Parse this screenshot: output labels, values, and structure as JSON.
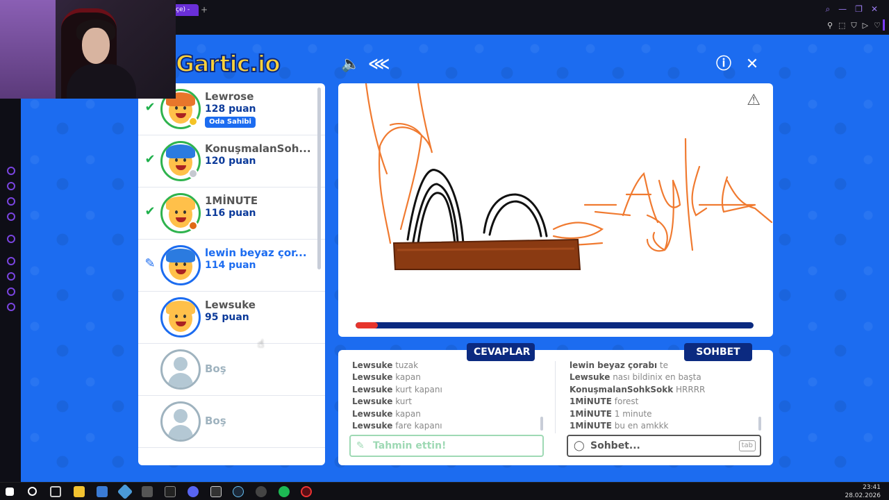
{
  "browser": {
    "tab_title": "çe) - ",
    "tab_add": "+"
  },
  "game": {
    "logo": "Gartic.io",
    "icons": [
      "sound-icon",
      "share-icon",
      "info-icon",
      "close-icon"
    ]
  },
  "players": [
    {
      "name": "Lewrose",
      "score": "128 puan",
      "status": "check",
      "badge": "Oda Sahibi",
      "dot": "#f4c326",
      "hair": "#e8762b"
    },
    {
      "name": "KonuşmalanSoh...",
      "score": "120 puan",
      "status": "check",
      "dot": "#c5c9d0",
      "hair": "#2b7be0"
    },
    {
      "name": "1MİNUTE",
      "score": "116 puan",
      "status": "check",
      "dot": "#e06a17",
      "hair": "#ffc04a"
    },
    {
      "name": "lewin beyaz çor...",
      "score": "114 puan",
      "status": "pencil",
      "hair": "#2b7be0"
    },
    {
      "name": "Lewsuke",
      "score": "95 puan",
      "status": "none",
      "hair": "#ffc04a"
    },
    {
      "name": "Boş",
      "empty": true
    },
    {
      "name": "Boş",
      "empty": true
    }
  ],
  "canvas": {
    "timer_progress": 0.055,
    "drawing_text": "Ayak"
  },
  "answers": {
    "label": "CEVAPLAR",
    "messages": [
      {
        "user": "Lewsuke",
        "text": "tuzak"
      },
      {
        "user": "Lewsuke",
        "text": "kapan"
      },
      {
        "user": "Lewsuke",
        "text": "kurt kapanı"
      },
      {
        "user": "Lewsuke",
        "text": "kurt"
      },
      {
        "user": "Lewsuke",
        "text": "kapan"
      },
      {
        "user": "Lewsuke",
        "text": "fare kapanı"
      }
    ],
    "placeholder": "Tahmin ettin!"
  },
  "chat": {
    "label": "SOHBET",
    "messages": [
      {
        "user": "lewin beyaz çorabı",
        "text": "te"
      },
      {
        "user": "Lewsuke",
        "text": "nası bildinix en başta"
      },
      {
        "user": "KonuşmalanSohkSokk",
        "text": "HRRRR"
      },
      {
        "user": "1MİNUTE",
        "text": "forest"
      },
      {
        "user": "1MİNUTE",
        "text": "1 minute"
      },
      {
        "user": "1MİNUTE",
        "text": "bu en amkkk"
      }
    ],
    "placeholder": "Sohbet...",
    "key_hint": "tab"
  },
  "taskbar": {
    "time": "23:41",
    "date": "28.02.2026"
  }
}
